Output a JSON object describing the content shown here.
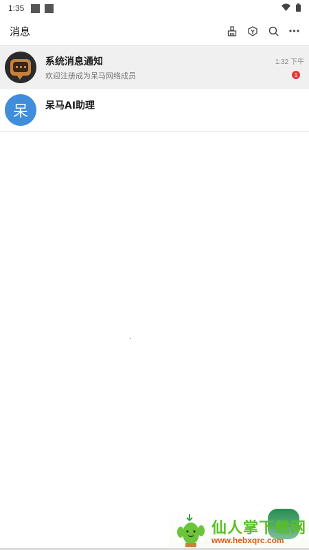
{
  "status_bar": {
    "time": "1:35"
  },
  "header": {
    "title": "消息",
    "icons": [
      "broom-icon",
      "shield-icon",
      "search-icon",
      "more-icon"
    ]
  },
  "conversations": [
    {
      "name": "系统消息通知",
      "preview": "欢迎注册成为呆马网络成员",
      "time": "1:32 下午",
      "unread": "1",
      "avatar": "chat-bubble-icon"
    },
    {
      "name": "呆马AI助理",
      "avatar_text": "呆"
    }
  ],
  "watermark": {
    "name": "仙人掌下载网",
    "url": "www.hebxqrc.com"
  },
  "colors": {
    "accent_blue": "#3f8ddb",
    "badge_red": "#e23a3a",
    "watermark_green": "#58c022",
    "watermark_orange": "#e05a1a"
  }
}
